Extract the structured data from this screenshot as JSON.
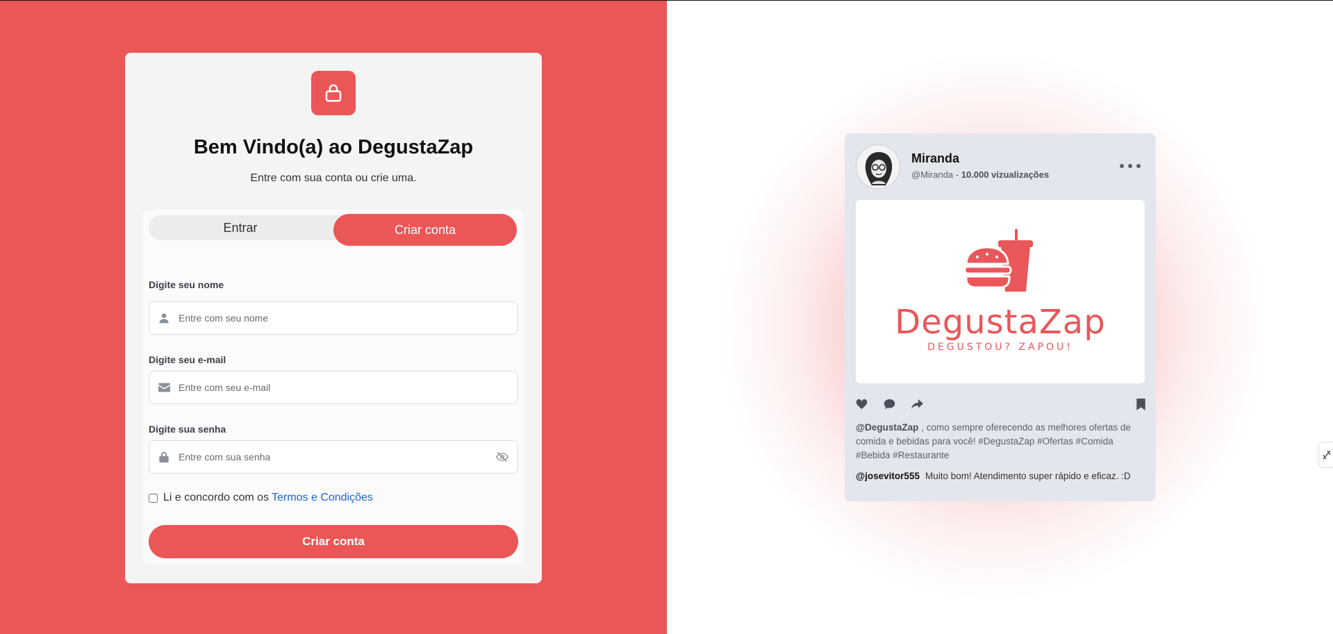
{
  "login_card": {
    "title": "Bem Vindo(a) ao DegustaZap",
    "subtitle": "Entre com sua conta ou crie uma.",
    "tabs": {
      "signin": "Entrar",
      "signup": "Criar conta"
    },
    "fields": {
      "name": {
        "label": "Digite seu nome",
        "placeholder": "Entre com seu nome",
        "value": ""
      },
      "email": {
        "label": "Digite seu e-mail",
        "placeholder": "Entre com seu e-mail",
        "value": ""
      },
      "password": {
        "label": "Digite sua senha",
        "placeholder": "Entre com sua senha",
        "value": ""
      }
    },
    "terms": {
      "text": "Li e concordo com os",
      "link": "Termos e Condições",
      "checked": false
    },
    "submit_label": "Criar conta"
  },
  "post": {
    "author": "Miranda",
    "handle": "@Miranda",
    "separator": " - ",
    "views": "10.000 vizualizações",
    "brand": {
      "name": "DegustaZap",
      "tagline": "DEGUSTOU? ZAPOU!"
    },
    "caption_mention": "@DegustaZap",
    "caption_text": " , como sempre oferecendo as melhores ofertas de comida e bebidas para você! #DegustaZap #Ofertas #Comida #Bebida #Restaurante",
    "comment_user": "@josevitor555",
    "comment_text": "Muito bom! Atendimento super rápido e eficaz. :D"
  },
  "icons": {
    "lock": "lock-icon",
    "user": "user-icon",
    "mail": "envelope-icon",
    "password": "padlock-icon",
    "eye": "eye-slash-icon",
    "like": "heart-icon",
    "comment": "comment-icon",
    "share": "share-icon",
    "bookmark": "bookmark-icon",
    "more": "more-dots-icon"
  },
  "colors": {
    "brand": "#eb5657",
    "link": "#1a63d6",
    "card_bg": "#f4f4f4",
    "post_bg": "#e4e6ee"
  }
}
